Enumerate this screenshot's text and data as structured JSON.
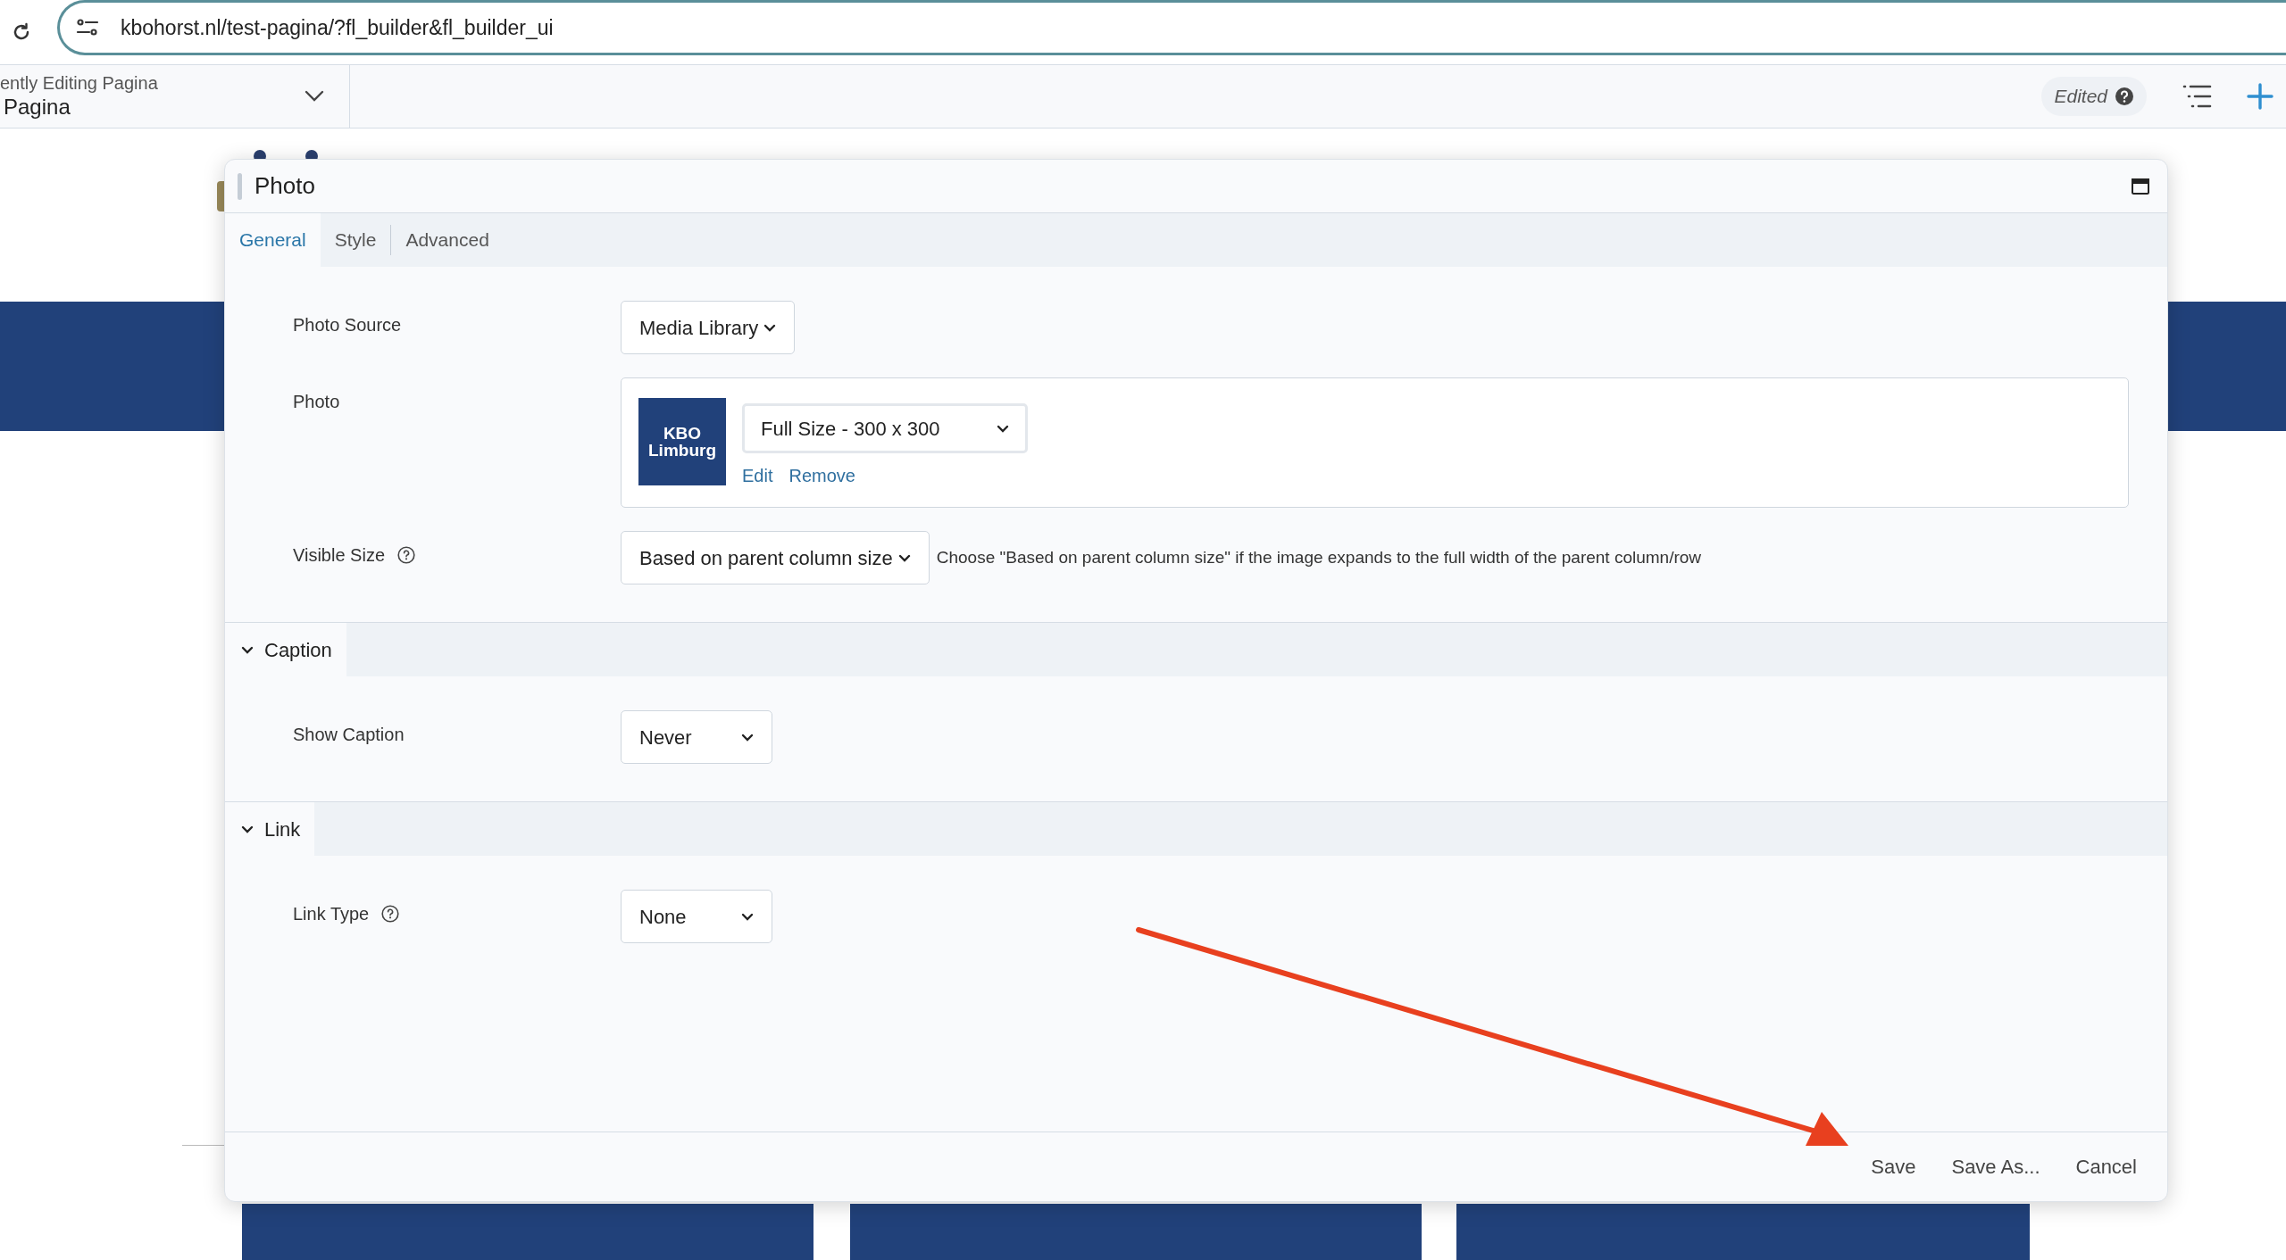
{
  "browser": {
    "url": "kbohorst.nl/test-pagina/?fl_builder&fl_builder_ui"
  },
  "builder_bar": {
    "editing_label": "ently Editing Pagina",
    "page_name": "Pagina",
    "status": "Edited"
  },
  "panel": {
    "title": "Photo",
    "tabs": [
      {
        "label": "General",
        "selected": true
      },
      {
        "label": "Style",
        "selected": false
      },
      {
        "label": "Advanced",
        "selected": false
      }
    ],
    "sections": [
      {
        "fields": [
          {
            "kind": "select",
            "label": "Photo Source",
            "value": "Media Library",
            "help": false
          },
          {
            "kind": "photo",
            "label": "Photo",
            "thumbnail_lines": [
              "KBO",
              "Limburg"
            ],
            "value": "Full Size - 300 x 300",
            "actions": [
              "Edit",
              "Remove"
            ],
            "help": false
          },
          {
            "kind": "select",
            "label": "Visible Size",
            "value": "Based on parent column size",
            "help": true,
            "description": "Choose \"Based on parent column size\" if the image expands to the full width of the parent column/row"
          }
        ]
      },
      {
        "title": "Caption",
        "expanded": true,
        "fields": [
          {
            "kind": "select",
            "label": "Show Caption",
            "value": "Never",
            "help": false
          }
        ]
      },
      {
        "title": "Link",
        "expanded": true,
        "fields": [
          {
            "kind": "select",
            "label": "Link Type",
            "value": "None",
            "help": true
          }
        ]
      }
    ],
    "buttons": [
      "Save",
      "Save As...",
      "Cancel"
    ]
  }
}
